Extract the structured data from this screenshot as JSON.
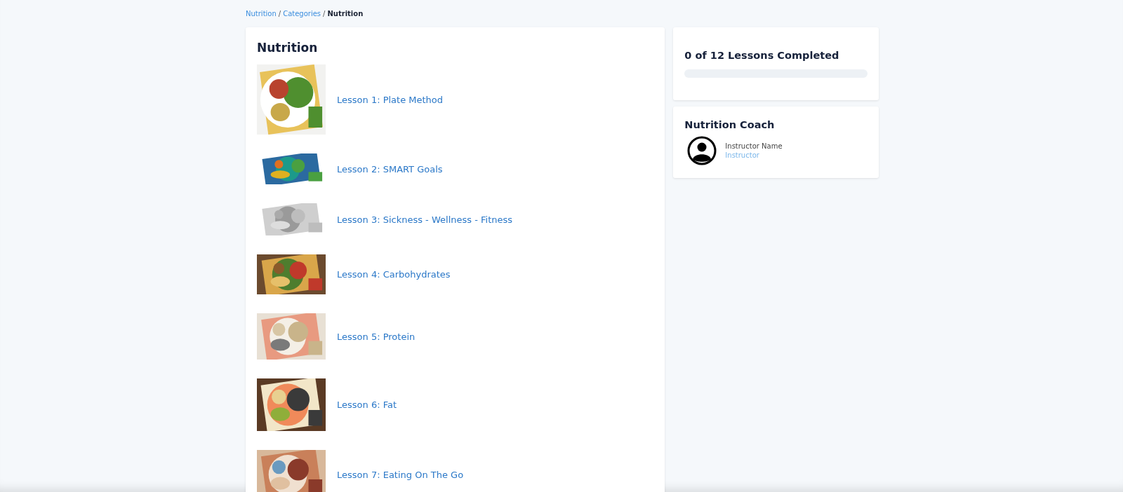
{
  "breadcrumb": [
    {
      "label": "Nutrition",
      "kind": "link"
    },
    {
      "label": "/",
      "kind": "separator"
    },
    {
      "label": "Categories",
      "kind": "link"
    },
    {
      "label": "/",
      "kind": "separator"
    },
    {
      "label": "Nutrition",
      "kind": "current"
    }
  ],
  "course": {
    "title": "Nutrition",
    "lessons": [
      {
        "title": "Lesson 1: Plate Method"
      },
      {
        "title": "Lesson 2: SMART Goals"
      },
      {
        "title": "Lesson 3: Sickness - Wellness - Fitness"
      },
      {
        "title": "Lesson 4: Carbohydrates"
      },
      {
        "title": "Lesson 5: Protein"
      },
      {
        "title": "Lesson 6: Fat"
      },
      {
        "title": "Lesson 7: Eating On The Go"
      }
    ]
  },
  "progress": {
    "label": "0 of 12 Lessons Completed",
    "level": 0
  },
  "coach": {
    "title": "Nutrition Coach",
    "name": "Instructor Name",
    "role": "Instructor"
  }
}
